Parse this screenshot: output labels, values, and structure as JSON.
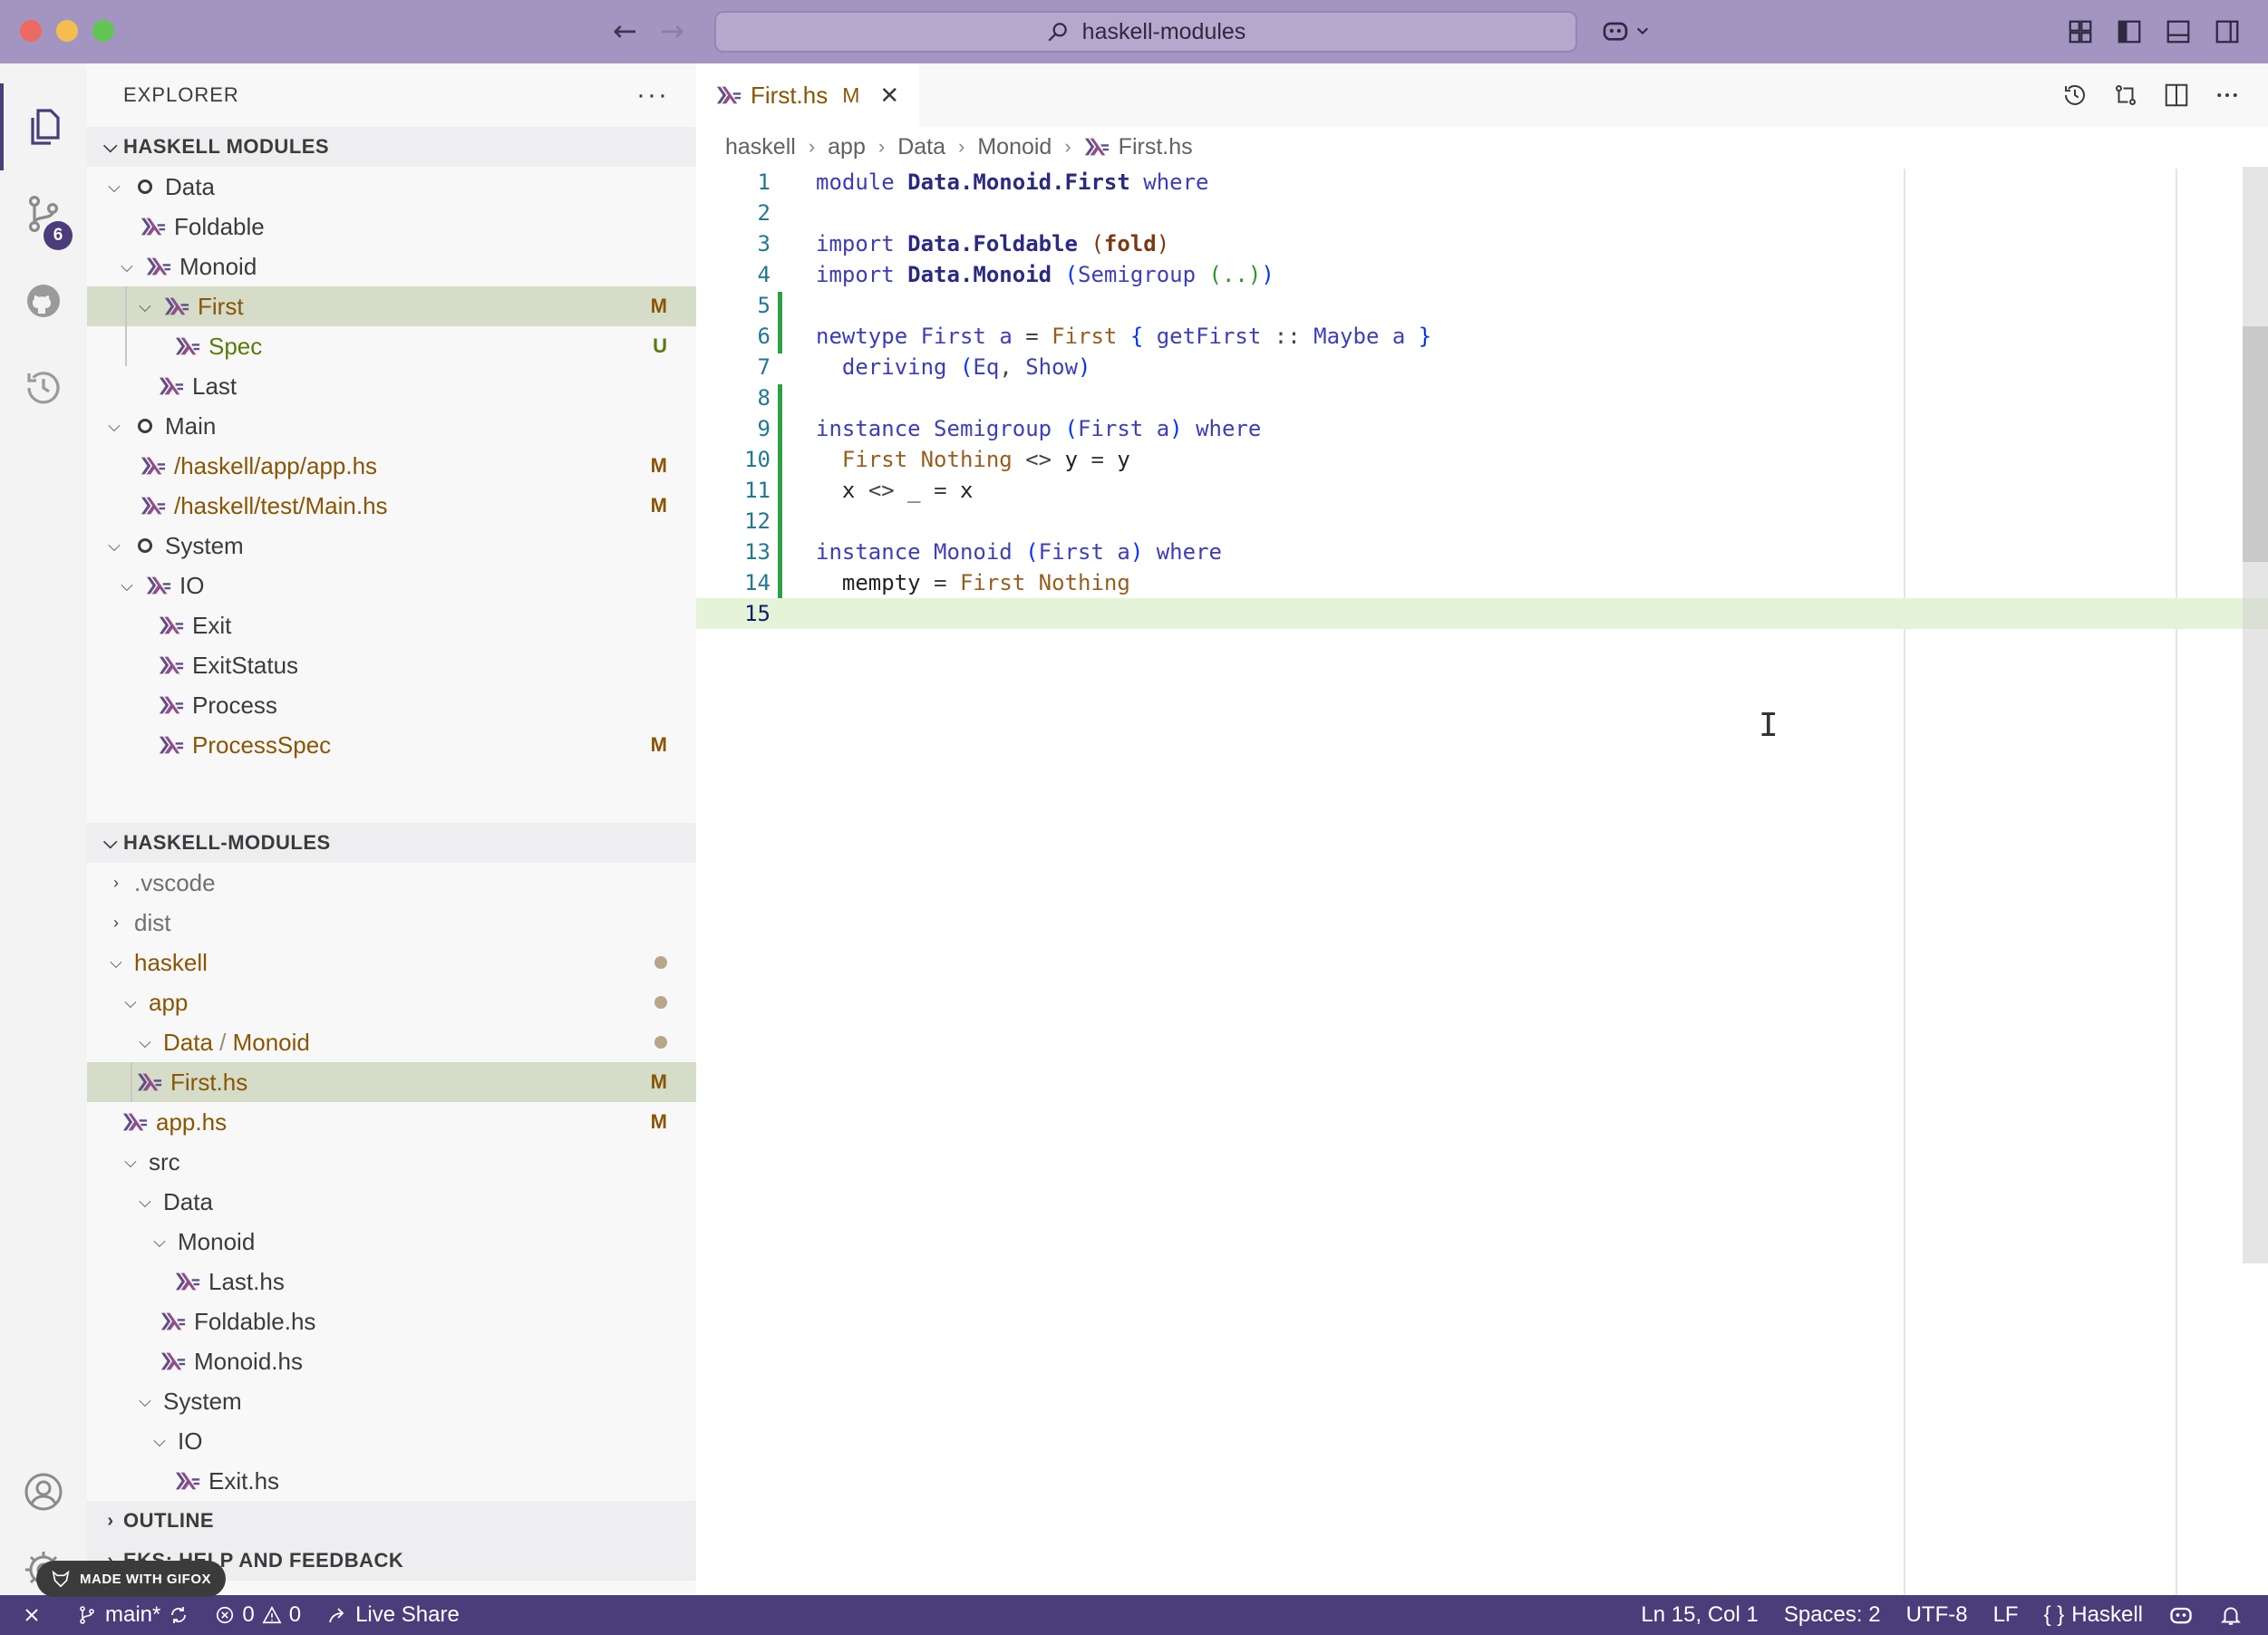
{
  "window": {
    "command_center": "haskell-modules"
  },
  "activity": {
    "scm_badge": "6"
  },
  "sidebar": {
    "title": "EXPLORER",
    "more": "···",
    "modules_section": {
      "title": "HASKELL MODULES",
      "rows": [
        {
          "label": "Data",
          "deco": ""
        },
        {
          "label": "Foldable",
          "deco": ""
        },
        {
          "label": "Monoid",
          "deco": ""
        },
        {
          "label": "First",
          "deco": "M"
        },
        {
          "label": "Spec",
          "deco": "U"
        },
        {
          "label": "Last",
          "deco": ""
        },
        {
          "label": "Main",
          "deco": ""
        },
        {
          "label": "/haskell/app/app.hs",
          "deco": "M"
        },
        {
          "label": "/haskell/test/Main.hs",
          "deco": "M"
        },
        {
          "label": "System",
          "deco": ""
        },
        {
          "label": "IO",
          "deco": ""
        },
        {
          "label": "Exit",
          "deco": ""
        },
        {
          "label": "ExitStatus",
          "deco": ""
        },
        {
          "label": "Process",
          "deco": ""
        },
        {
          "label": "ProcessSpec",
          "deco": "M"
        }
      ]
    },
    "files_section": {
      "title": "HASKELL-MODULES",
      "rows": [
        {
          "label": ".vscode",
          "deco": ""
        },
        {
          "label": "dist",
          "deco": ""
        },
        {
          "label": "haskell",
          "deco": ""
        },
        {
          "label": "app",
          "deco": ""
        },
        {
          "label": "Data",
          "sep": "/",
          "label2": "Monoid",
          "deco": ""
        },
        {
          "label": "First.hs",
          "deco": "M"
        },
        {
          "label": "app.hs",
          "deco": "M"
        },
        {
          "label": "src",
          "deco": ""
        },
        {
          "label": "Data",
          "deco": ""
        },
        {
          "label": "Monoid",
          "deco": ""
        },
        {
          "label": "Last.hs",
          "deco": ""
        },
        {
          "label": "Foldable.hs",
          "deco": ""
        },
        {
          "label": "Monoid.hs",
          "deco": ""
        },
        {
          "label": "System",
          "deco": ""
        },
        {
          "label": "IO",
          "deco": ""
        },
        {
          "label": "Exit.hs",
          "deco": ""
        }
      ]
    },
    "outline": "OUTLINE",
    "help": "EKS: HELP AND FEEDBACK"
  },
  "editor": {
    "tab": {
      "label": "First.hs",
      "status": "M",
      "close": "✕"
    },
    "breadcrumb": [
      "haskell",
      "app",
      "Data",
      "Monoid",
      "First.hs"
    ],
    "line_numbers": [
      "1",
      "2",
      "3",
      "4",
      "5",
      "6",
      "7",
      "8",
      "9",
      "10",
      "11",
      "12",
      "13",
      "14",
      "15"
    ],
    "code": {
      "l1": [
        "module",
        "Data.Monoid.First",
        "where"
      ],
      "l3": [
        "import",
        "Data.Foldable",
        "(",
        "fold",
        ")"
      ],
      "l4": [
        "import",
        "Data.Monoid",
        "(",
        "Semigroup",
        "(",
        "..",
        ")",
        ")"
      ],
      "l6": [
        "newtype",
        "First",
        "a",
        "=",
        "First",
        "{",
        "getFirst",
        "::",
        "Maybe",
        "a",
        "}"
      ],
      "l7": [
        "deriving",
        "(",
        "Eq",
        ",",
        "Show",
        ")"
      ],
      "l9": [
        "instance",
        "Semigroup",
        "(",
        "First",
        "a",
        ")",
        "where"
      ],
      "l10": [
        "First",
        "Nothing",
        "<>",
        "y",
        "=",
        "y"
      ],
      "l11": [
        "x",
        "<>",
        "_",
        "=",
        "x"
      ],
      "l13": [
        "instance",
        "Monoid",
        "(",
        "First",
        "a",
        ")",
        "where"
      ],
      "l14": [
        "mempty",
        "=",
        "First",
        "Nothing"
      ]
    }
  },
  "statusbar": {
    "branch": "main*",
    "errors": "0",
    "warnings": "0",
    "live_share": "Live Share",
    "position": "Ln 15, Col 1",
    "spaces": "Spaces: 2",
    "encoding": "UTF-8",
    "eol": "LF",
    "language": "Haskell"
  },
  "watermark": "MADE WITH GIFOX"
}
